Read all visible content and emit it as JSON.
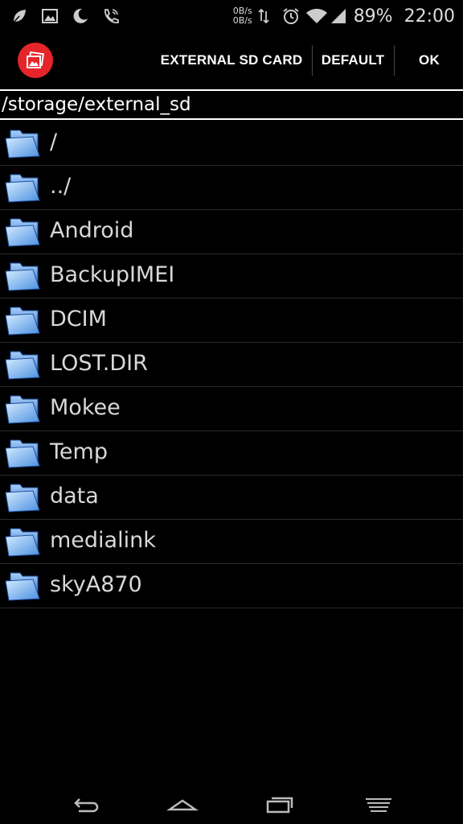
{
  "status_bar": {
    "icons_left": [
      "leaf-icon",
      "image-icon",
      "moon-icon",
      "phone-wifi-icon"
    ],
    "net_speed_up": "0B/s",
    "net_speed_down": "0B/s",
    "battery_percent": "89%",
    "time": "22:00"
  },
  "action_bar": {
    "app_icon": "image-picker-icon",
    "external_sd_label": "EXTERNAL SD CARD",
    "default_label": "DEFAULT",
    "ok_label": "OK"
  },
  "path": "/storage/external_sd",
  "folders": [
    {
      "name": "/"
    },
    {
      "name": "../"
    },
    {
      "name": "Android"
    },
    {
      "name": "BackupIMEI"
    },
    {
      "name": "DCIM"
    },
    {
      "name": "LOST.DIR"
    },
    {
      "name": "Mokee"
    },
    {
      "name": "Temp"
    },
    {
      "name": "data"
    },
    {
      "name": "medialink"
    },
    {
      "name": "skyA870"
    }
  ],
  "nav_bar": [
    "back-icon",
    "home-icon",
    "recent-apps-icon",
    "menu-icon"
  ],
  "colors": {
    "background": "#000000",
    "app_logo": "#e5252a",
    "folder_blue": "#4a8fe0",
    "text": "#d8d8d8"
  }
}
